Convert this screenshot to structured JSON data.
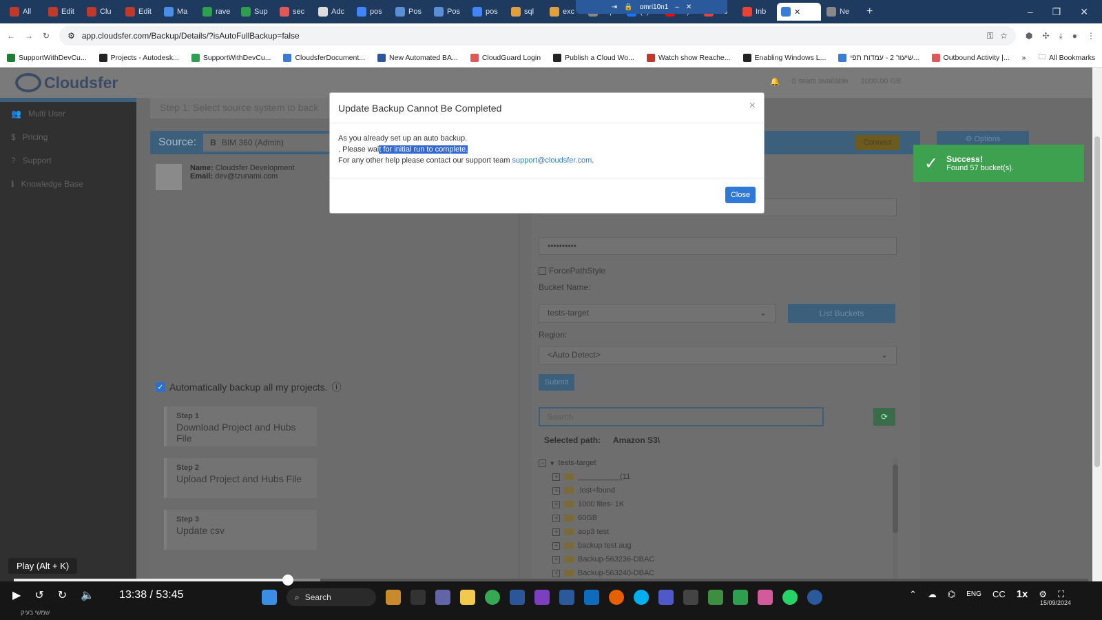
{
  "browser": {
    "tabs": [
      {
        "label": "All",
        "color": "#c0392b"
      },
      {
        "label": "Edit",
        "color": "#c0392b"
      },
      {
        "label": "Clu",
        "color": "#c0392b"
      },
      {
        "label": "Edit",
        "color": "#c0392b"
      },
      {
        "label": "Ma",
        "color": "#4a8fe7"
      },
      {
        "label": "rave",
        "color": "#2e9e4f"
      },
      {
        "label": "Sup",
        "color": "#2e9e4f"
      },
      {
        "label": "sec",
        "color": "#e25858"
      },
      {
        "label": "Adc",
        "color": "#dddddd"
      },
      {
        "label": "pos",
        "color": "#4285f4"
      },
      {
        "label": "Pos",
        "color": "#5a8fd8"
      },
      {
        "label": "Pos",
        "color": "#5a8fd8"
      },
      {
        "label": "pos",
        "color": "#4285f4"
      },
      {
        "label": "sql",
        "color": "#e0a040"
      },
      {
        "label": "exc",
        "color": "#e0a040"
      },
      {
        "label": "nep",
        "color": "#888888"
      },
      {
        "label": "(2)",
        "color": "#1877f2"
      },
      {
        "label": "24)",
        "color": "#ff0000"
      },
      {
        "label": "Inb",
        "color": "#ea4335"
      },
      {
        "label": "Inb",
        "color": "#ea4335"
      },
      {
        "label": "Ne",
        "color": "#888888"
      }
    ],
    "active_tab_label": "",
    "remote_session_label": "omri10n1",
    "url": "app.cloudsfer.com/Backup/Details/?isAutoFullBackup=false",
    "bookmarks": [
      {
        "label": "SupportWithDevCu...",
        "color": "#1e7e34"
      },
      {
        "label": "Projects - Autodesk...",
        "color": "#222222"
      },
      {
        "label": "SupportWithDevCu...",
        "color": "#2e9e4f"
      },
      {
        "label": "CloudsferDocument...",
        "color": "#3a7bd5"
      },
      {
        "label": "New Automated BA...",
        "color": "#2b579a"
      },
      {
        "label": "CloudGuard Login",
        "color": "#e25858"
      },
      {
        "label": "Publish a Cloud Wo...",
        "color": "#222222"
      },
      {
        "label": "Watch show Reache...",
        "color": "#c0392b"
      },
      {
        "label": "Enabling Windows L...",
        "color": "#222222"
      },
      {
        "label": "שיעור 2 - עמדות תפי...",
        "color": "#3a7bd5"
      },
      {
        "label": "Outbound Activity |...",
        "color": "#e25858"
      }
    ],
    "all_bookmarks": "All Bookmarks"
  },
  "app": {
    "logo_text": "Cloudsfer",
    "header_info": [
      "0 seats available",
      "1000.00 GB"
    ],
    "sidebar": [
      {
        "label": "Multi User",
        "icon": "users-icon"
      },
      {
        "label": "Pricing",
        "icon": "dollar-icon"
      },
      {
        "label": "Support",
        "icon": "help-icon"
      },
      {
        "label": "Knowledge Base",
        "icon": "info-icon"
      }
    ],
    "step_title": "Step 1: Select source system to back",
    "source_label": "Source:",
    "source_value": "BIM 360 (Admin)",
    "connect_label": "Connect",
    "options_label": "⚙ Options",
    "user": {
      "name_label": "Name:",
      "name": "Cloudsfer Development",
      "email_label": "Email:",
      "email": "dev@tzunami.com"
    },
    "auto_backup_label": "Automatically backup all my projects.",
    "steps": [
      {
        "num": "Step 1",
        "text": "Download Project and Hubs File"
      },
      {
        "num": "Step 2",
        "text": "Upload Project and Hubs File"
      },
      {
        "num": "Step 3",
        "text": "Update csv"
      }
    ],
    "right": {
      "secret_value": "••••••••••",
      "force_path_label": "ForcePathStyle",
      "bucket_label": "Bucket Name:",
      "bucket_value": "tests-target",
      "list_buckets_label": "List Buckets",
      "region_label": "Region:",
      "region_value": "<Auto Detect>",
      "submit_label": "Submit",
      "search_placeholder": "Search",
      "selected_path_label": "Selected path:",
      "selected_path_value": "Amazon S3\\",
      "tree_root": "tests-target",
      "tree_items": [
        "__________(11",
        ".lost+found",
        "1000 files- 1K",
        "60GB",
        "aop3 test",
        "backup test aug",
        "Backup-563236-DBAC",
        "Backup-563240-DBAC",
        "Backup-565957-DBAE"
      ]
    }
  },
  "toast": {
    "title": "Success!",
    "message": "Found 57 bucket(s)."
  },
  "modal": {
    "title": "Update Backup Cannot Be Completed",
    "line1": "As you already set up an auto backup.",
    "line2_pre": ". Please wai",
    "line2_hl": "t for initial run to complete.",
    "line3_pre": "For any other help please contact our support team ",
    "line3_email": "support@cloudsfer.com",
    "line3_post": ".",
    "close_label": "Close"
  },
  "player": {
    "tooltip": "Play (Alt + K)",
    "timecode": "13:38 / 53:45",
    "speed": "1x",
    "progress": 0.255,
    "buffered": 0.285,
    "taskbar_search": "Search",
    "date": "15/09/2024",
    "lang": "ENG",
    "hebrew_caption": "שמשי בעיק"
  }
}
